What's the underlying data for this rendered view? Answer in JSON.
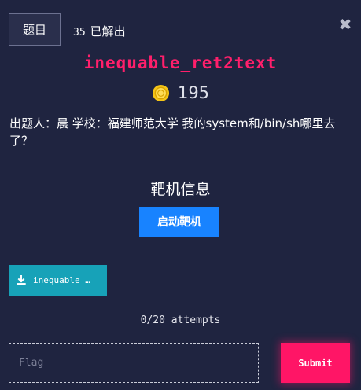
{
  "header": {
    "tab_label": "题目",
    "solves_count": "35",
    "solves_label": "已解出",
    "close_glyph": "✖"
  },
  "challenge": {
    "title": "inequable_ret2text",
    "points": "195",
    "description": "出题人：晨 学校：福建师范大学 我的system和/bin/sh哪里去了？"
  },
  "instance": {
    "section_title": "靶机信息",
    "start_label": "启动靶机"
  },
  "files": [
    {
      "label": "inequable_…",
      "icon": "download-icon"
    }
  ],
  "attempts": "0/20 attempts",
  "flag_form": {
    "placeholder": "Flag",
    "value": "",
    "submit_label": "Submit"
  },
  "colors": {
    "background": "#1f2440",
    "title": "#ff1f6b",
    "primary_button": "#1883ff",
    "file_button": "#17a2b8",
    "submit_button": "#ff1566",
    "coin": "#f5c518"
  }
}
